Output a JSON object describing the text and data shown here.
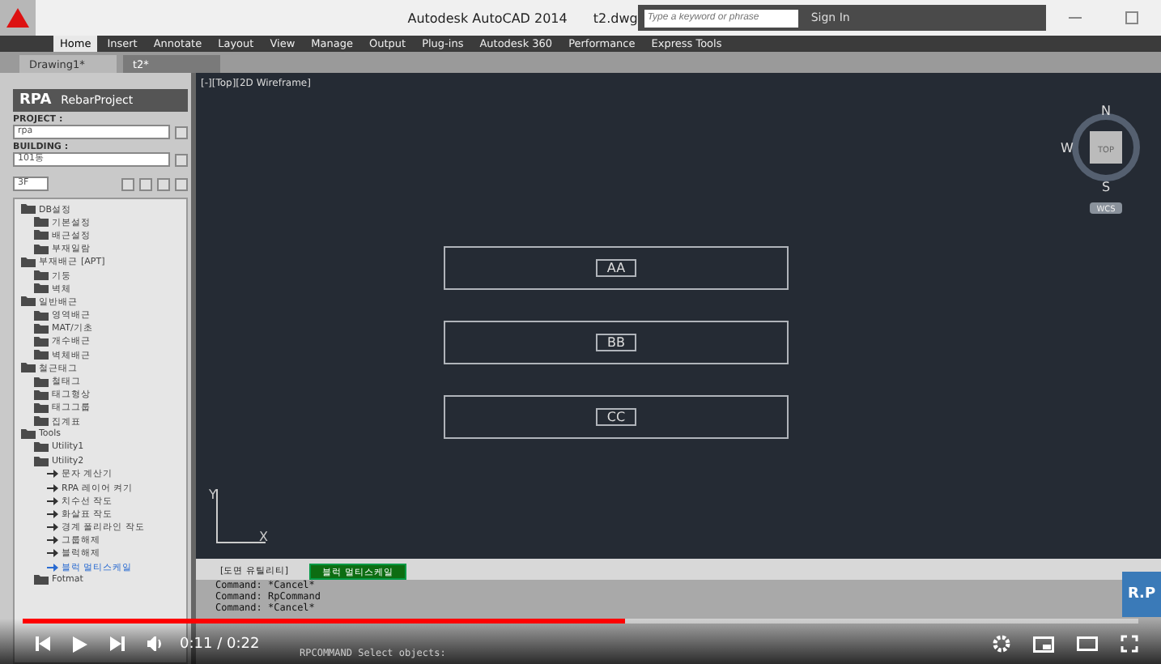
{
  "title_bar": {
    "title": "Autodesk AutoCAD 2014",
    "file": "t2.dwg",
    "search": {
      "placeholder": "Type a keyword or phrase"
    },
    "sign_in": "Sign In"
  },
  "ribbon_tabs": [
    {
      "label": "Home",
      "selected": true
    },
    {
      "label": "Insert",
      "selected": false
    },
    {
      "label": "Annotate",
      "selected": false
    },
    {
      "label": "Layout",
      "selected": false
    },
    {
      "label": "View",
      "selected": false
    },
    {
      "label": "Manage",
      "selected": false
    },
    {
      "label": "Output",
      "selected": false
    },
    {
      "label": "Plug-ins",
      "selected": false
    },
    {
      "label": "Autodesk 360",
      "selected": false
    },
    {
      "label": "Performance",
      "selected": false
    },
    {
      "label": "Express Tools",
      "selected": false
    }
  ],
  "doc_tabs": [
    {
      "label": "Drawing1*",
      "selected": false
    },
    {
      "label": "t2*",
      "selected": true
    }
  ],
  "panel": {
    "logo": "RPA",
    "name": "RebarProject",
    "project_label": "PROJECT :",
    "project": "rpa",
    "building_label": "BUILDING :",
    "building": "101동",
    "floor": "3F",
    "tree": [
      {
        "label": "DB설정",
        "children": [
          {
            "label": "기본설정"
          },
          {
            "label": "배근설정"
          },
          {
            "label": "부재일람"
          }
        ]
      },
      {
        "label": "부재배근",
        "tag": "[APT]",
        "children": [
          {
            "label": "기둥"
          },
          {
            "label": "벽체"
          }
        ]
      },
      {
        "label": "일반배근",
        "children": [
          {
            "label": "영역배근"
          },
          {
            "label": "MAT/기초"
          },
          {
            "label": "개수배근"
          },
          {
            "label": "벽체배근"
          }
        ]
      },
      {
        "label": "철근태그",
        "children": [
          {
            "label": "철태그"
          },
          {
            "label": "태그형상"
          },
          {
            "label": "태그그룹"
          },
          {
            "label": "집계표"
          }
        ]
      },
      {
        "label": "Tools",
        "children": [
          {
            "label": "Utility1"
          },
          {
            "label": "Utility2",
            "children": [
              {
                "label": "문자 계산기",
                "kind": "command",
                "selected": false
              },
              {
                "label": "RPA 레이어 켜기",
                "kind": "command",
                "selected": false
              },
              {
                "label": "치수선 작도",
                "kind": "command",
                "selected": false
              },
              {
                "label": "화살표 작도",
                "kind": "command",
                "selected": false
              },
              {
                "label": "경계 폴리라인 작도",
                "kind": "command",
                "selected": false
              },
              {
                "label": "그룹해제",
                "kind": "command",
                "selected": false
              },
              {
                "label": "블럭해제",
                "kind": "command",
                "selected": false
              },
              {
                "label": "블럭 멀티스케일",
                "kind": "command",
                "selected": true
              }
            ]
          },
          {
            "label": "Fotmat"
          }
        ]
      }
    ]
  },
  "viewport": {
    "label": "[-][Top][2D Wireframe]",
    "compass": {
      "n": "N",
      "w": "W",
      "s": "S",
      "top": "TOP",
      "wcs": "WCS"
    },
    "ucs": {
      "x": "X",
      "y": "Y"
    },
    "blocks": [
      {
        "label": "AA"
      },
      {
        "label": "BB"
      },
      {
        "label": "CC"
      }
    ]
  },
  "command": {
    "tabs": [
      {
        "label": "[도면 유틸리티]",
        "selected": false
      },
      {
        "label": "블럭 멀티스케일",
        "selected": true
      }
    ],
    "history": [
      "Command: *Cancel*",
      "Command: RpCommand",
      "Command: *Cancel*"
    ],
    "prompt": "RPCOMMAND Select objects:",
    "badge": "R.P"
  },
  "player": {
    "time": "0:11 / 0:22",
    "progress": {
      "level": 0.54
    }
  }
}
